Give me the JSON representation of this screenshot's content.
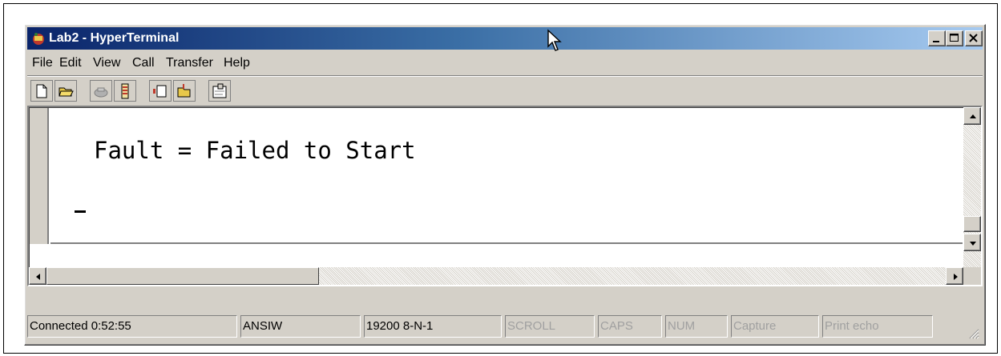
{
  "window": {
    "title": "Lab2 - HyperTerminal"
  },
  "menu": {
    "items": [
      "File",
      "Edit",
      "View",
      "Call",
      "Transfer",
      "Help"
    ]
  },
  "toolbar": {
    "tools": [
      "new-icon",
      "open-icon",
      "call-icon",
      "disconnect-icon",
      "send-icon",
      "receive-icon",
      "properties-icon"
    ]
  },
  "terminal": {
    "line1": "Fault = Failed to Start"
  },
  "statusbar": {
    "connected": "Connected 0:52:55",
    "emulation": "ANSIW",
    "settings": "19200 8-N-1",
    "scroll": "SCROLL",
    "caps": "CAPS",
    "num": "NUM",
    "capture": "Capture",
    "print_echo": "Print echo"
  },
  "colors": {
    "title_start": "#0a246a",
    "title_end": "#a6caf0",
    "chrome": "#d4d0c8"
  }
}
